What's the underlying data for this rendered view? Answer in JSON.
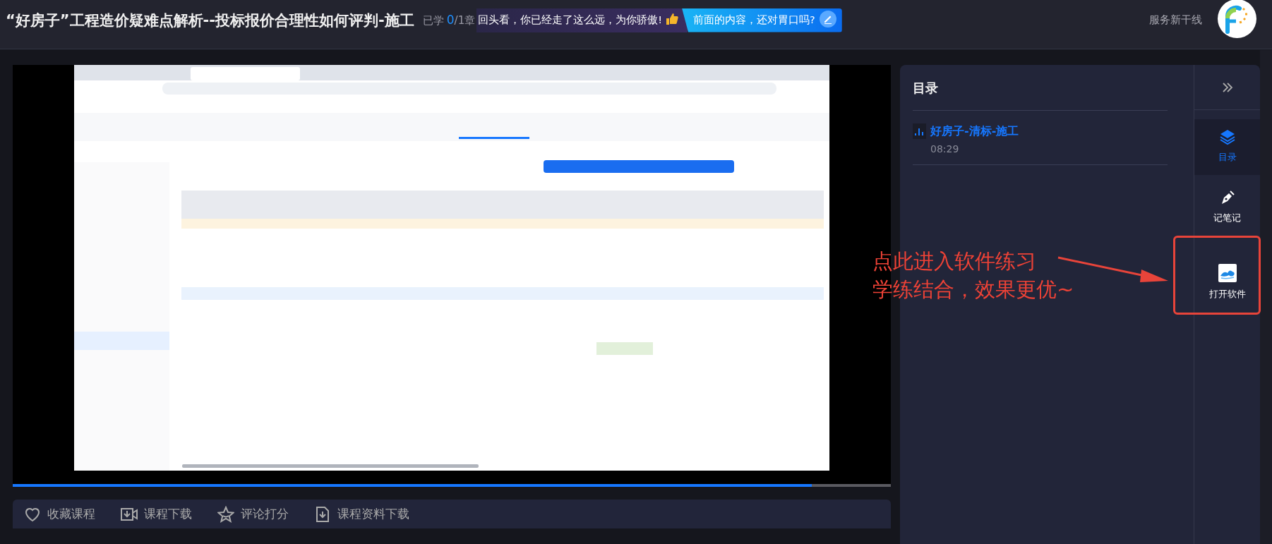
{
  "header": {
    "title": "“好房子”工程造价疑难点解析--投标报价合理性如何评判-施工",
    "progress": {
      "label": "已学",
      "done": "0",
      "total": "/1章"
    },
    "banner": {
      "message": "回头看，你已经走了这么远，为你骄傲!",
      "prompt": "前面的内容，还对胃口吗?"
    },
    "service_label": "服务新干线"
  },
  "video": {
    "kind": "picture",
    "progress": {
      "level": 0.91
    }
  },
  "actions": [
    {
      "kind": "heart",
      "label": "收藏课程"
    },
    {
      "kind": "video-download",
      "label": "课程下载"
    },
    {
      "kind": "star",
      "label": "评论打分"
    },
    {
      "kind": "file-download",
      "label": "课程资料下载"
    }
  ],
  "catalog": {
    "title": "目录",
    "items": [
      {
        "title": "好房子-清标-施工",
        "duration": "08:29",
        "selected": true
      }
    ]
  },
  "rail": [
    {
      "kind": "catalog",
      "label": "目录",
      "selected": true
    },
    {
      "kind": "notes",
      "label": "记笔记",
      "selected": false
    },
    {
      "kind": "software",
      "label": "打开软件",
      "selected": false
    }
  ],
  "annotation": {
    "lines": [
      "点此进入软件练习",
      "学练结合，效果更优~"
    ]
  }
}
